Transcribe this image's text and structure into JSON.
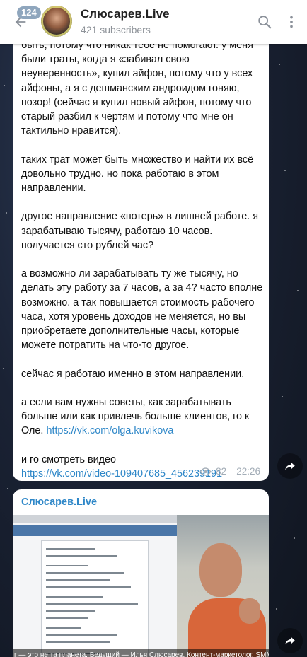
{
  "header": {
    "back_badge": "124",
    "channel_title": "Слюсарев.Live",
    "subscribers": "421 subscribers",
    "back_icon": "arrow-left-icon",
    "search_icon": "search-icon",
    "menu_icon": "more-vertical-icon"
  },
  "message1": {
    "text": "быть, потому что никак тебе не помогают. у меня были траты, когда я «забивал свою неуверенность», купил айфон, потому что у всех айфоны, а я с дешманским андроидом гоняю, позор! (сейчас я купил новый айфон, потому что старый разбил к чертям и потому что мне он тактильно нравится).\n\nтаких трат может быть множество и найти их всё довольно трудно. но пока работаю в этом направлении.\n\nдругое направление «потерь» в лишней работе. я зарабатываю тысячу, работаю 10 часов. получается сто рублей час?\n\nа возможно ли зарабатывать ту же тысячу, но делать эту работу за 7 часов, а за 4? часто вполне возможно. а так повышается стоимость рабочего часа, хотя уровень доходов не меняется, но вы приобретаете дополнительные часы, которые можете потратить на что-то другое.\n\nсейчас я работаю именно в этом направлении.\n\nа если вам нужны советы, как зарабатывать больше или как привлечь больше клиентов, го к Оле. ",
    "link1": "https://vk.com/olga.kuvikova",
    "text2": "\n\nи го смотреть видео\n",
    "link2": "https://vk.com/video-109407685_456239191",
    "views": "82",
    "time": "22:26"
  },
  "message2": {
    "channel_name": "Слюсарев.Live",
    "video_caption": "г — это не та планета. Ведущий — Илья Слюсарев. Контент-маркетолог. SMM-специалист"
  },
  "colors": {
    "accent": "#2e87c8",
    "meta": "#a3adb7",
    "header_bg": "#ffffff"
  }
}
